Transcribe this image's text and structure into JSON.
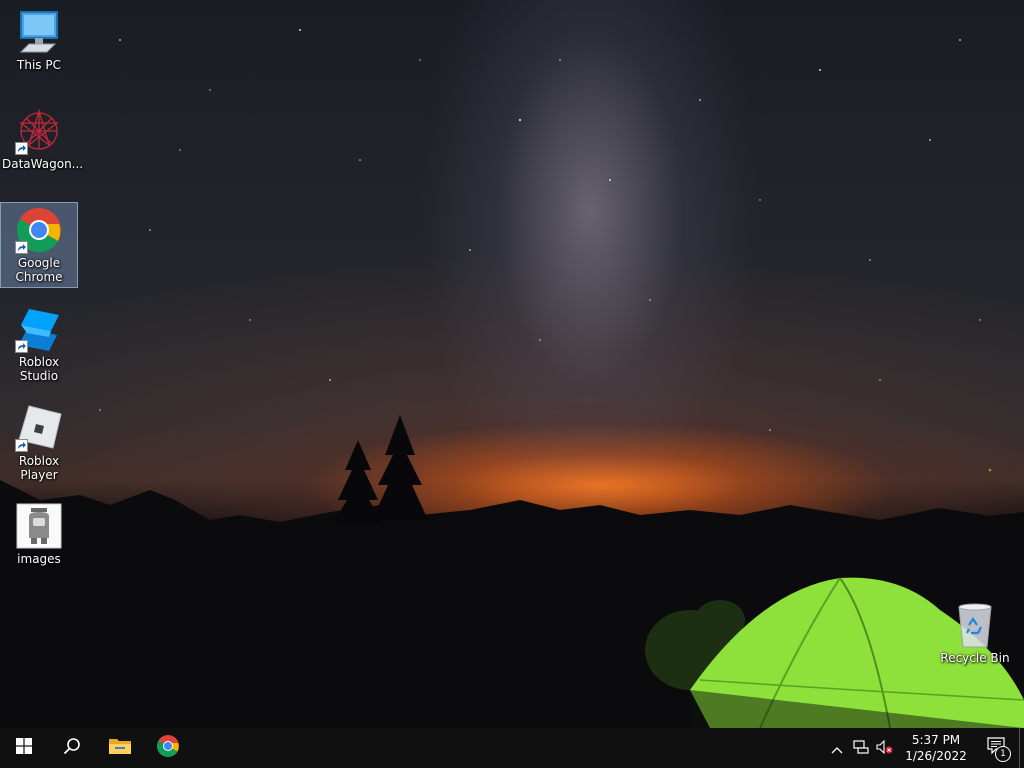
{
  "desktop": {
    "icons": [
      {
        "label": "This PC",
        "icon": "computer-icon"
      },
      {
        "label": "DataWagon...",
        "icon": "datawagon-icon"
      },
      {
        "label": "Google Chrome",
        "icon": "chrome-icon"
      },
      {
        "label": "Roblox Studio",
        "icon": "roblox-studio-icon"
      },
      {
        "label": "Roblox Player",
        "icon": "roblox-player-icon"
      },
      {
        "label": "images",
        "icon": "image-file-icon"
      },
      {
        "label": "Recycle Bin",
        "icon": "recycle-bin-icon"
      }
    ]
  },
  "taskbar": {
    "buttons": [
      {
        "name": "start",
        "icon": "windows-logo-icon"
      },
      {
        "name": "search",
        "icon": "search-icon"
      },
      {
        "name": "file-explorer",
        "icon": "folder-icon"
      },
      {
        "name": "chrome",
        "icon": "chrome-icon"
      }
    ],
    "tray": {
      "icons": [
        "chevron-up-icon",
        "network-icon",
        "speaker-muted-icon"
      ],
      "time": "5:37 PM",
      "date": "1/26/2022",
      "notification_count": "1"
    }
  },
  "colors": {
    "taskbar_bg": "#101010",
    "selection": "#7896be",
    "tent": "#8ee03a",
    "horizon_glow": "#ff7a1e"
  }
}
